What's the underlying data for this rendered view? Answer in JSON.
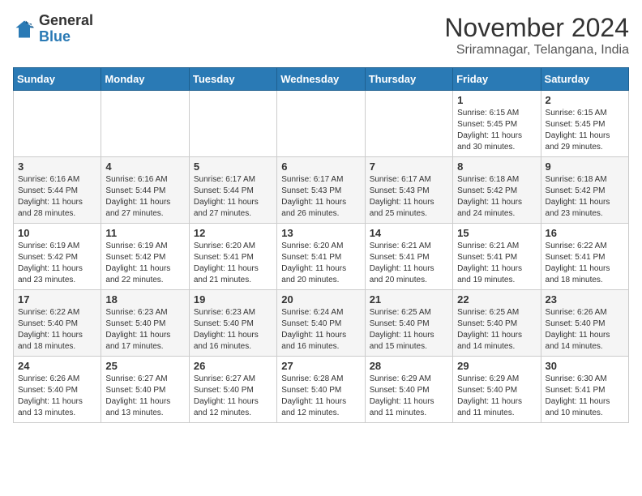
{
  "header": {
    "logo_general": "General",
    "logo_blue": "Blue",
    "title": "November 2024",
    "subtitle": "Sriramnagar, Telangana, India"
  },
  "weekdays": [
    "Sunday",
    "Monday",
    "Tuesday",
    "Wednesday",
    "Thursday",
    "Friday",
    "Saturday"
  ],
  "weeks": [
    [
      {
        "day": "",
        "info": ""
      },
      {
        "day": "",
        "info": ""
      },
      {
        "day": "",
        "info": ""
      },
      {
        "day": "",
        "info": ""
      },
      {
        "day": "",
        "info": ""
      },
      {
        "day": "1",
        "info": "Sunrise: 6:15 AM\nSunset: 5:45 PM\nDaylight: 11 hours and 30 minutes."
      },
      {
        "day": "2",
        "info": "Sunrise: 6:15 AM\nSunset: 5:45 PM\nDaylight: 11 hours and 29 minutes."
      }
    ],
    [
      {
        "day": "3",
        "info": "Sunrise: 6:16 AM\nSunset: 5:44 PM\nDaylight: 11 hours and 28 minutes."
      },
      {
        "day": "4",
        "info": "Sunrise: 6:16 AM\nSunset: 5:44 PM\nDaylight: 11 hours and 27 minutes."
      },
      {
        "day": "5",
        "info": "Sunrise: 6:17 AM\nSunset: 5:44 PM\nDaylight: 11 hours and 27 minutes."
      },
      {
        "day": "6",
        "info": "Sunrise: 6:17 AM\nSunset: 5:43 PM\nDaylight: 11 hours and 26 minutes."
      },
      {
        "day": "7",
        "info": "Sunrise: 6:17 AM\nSunset: 5:43 PM\nDaylight: 11 hours and 25 minutes."
      },
      {
        "day": "8",
        "info": "Sunrise: 6:18 AM\nSunset: 5:42 PM\nDaylight: 11 hours and 24 minutes."
      },
      {
        "day": "9",
        "info": "Sunrise: 6:18 AM\nSunset: 5:42 PM\nDaylight: 11 hours and 23 minutes."
      }
    ],
    [
      {
        "day": "10",
        "info": "Sunrise: 6:19 AM\nSunset: 5:42 PM\nDaylight: 11 hours and 23 minutes."
      },
      {
        "day": "11",
        "info": "Sunrise: 6:19 AM\nSunset: 5:42 PM\nDaylight: 11 hours and 22 minutes."
      },
      {
        "day": "12",
        "info": "Sunrise: 6:20 AM\nSunset: 5:41 PM\nDaylight: 11 hours and 21 minutes."
      },
      {
        "day": "13",
        "info": "Sunrise: 6:20 AM\nSunset: 5:41 PM\nDaylight: 11 hours and 20 minutes."
      },
      {
        "day": "14",
        "info": "Sunrise: 6:21 AM\nSunset: 5:41 PM\nDaylight: 11 hours and 20 minutes."
      },
      {
        "day": "15",
        "info": "Sunrise: 6:21 AM\nSunset: 5:41 PM\nDaylight: 11 hours and 19 minutes."
      },
      {
        "day": "16",
        "info": "Sunrise: 6:22 AM\nSunset: 5:41 PM\nDaylight: 11 hours and 18 minutes."
      }
    ],
    [
      {
        "day": "17",
        "info": "Sunrise: 6:22 AM\nSunset: 5:40 PM\nDaylight: 11 hours and 18 minutes."
      },
      {
        "day": "18",
        "info": "Sunrise: 6:23 AM\nSunset: 5:40 PM\nDaylight: 11 hours and 17 minutes."
      },
      {
        "day": "19",
        "info": "Sunrise: 6:23 AM\nSunset: 5:40 PM\nDaylight: 11 hours and 16 minutes."
      },
      {
        "day": "20",
        "info": "Sunrise: 6:24 AM\nSunset: 5:40 PM\nDaylight: 11 hours and 16 minutes."
      },
      {
        "day": "21",
        "info": "Sunrise: 6:25 AM\nSunset: 5:40 PM\nDaylight: 11 hours and 15 minutes."
      },
      {
        "day": "22",
        "info": "Sunrise: 6:25 AM\nSunset: 5:40 PM\nDaylight: 11 hours and 14 minutes."
      },
      {
        "day": "23",
        "info": "Sunrise: 6:26 AM\nSunset: 5:40 PM\nDaylight: 11 hours and 14 minutes."
      }
    ],
    [
      {
        "day": "24",
        "info": "Sunrise: 6:26 AM\nSunset: 5:40 PM\nDaylight: 11 hours and 13 minutes."
      },
      {
        "day": "25",
        "info": "Sunrise: 6:27 AM\nSunset: 5:40 PM\nDaylight: 11 hours and 13 minutes."
      },
      {
        "day": "26",
        "info": "Sunrise: 6:27 AM\nSunset: 5:40 PM\nDaylight: 11 hours and 12 minutes."
      },
      {
        "day": "27",
        "info": "Sunrise: 6:28 AM\nSunset: 5:40 PM\nDaylight: 11 hours and 12 minutes."
      },
      {
        "day": "28",
        "info": "Sunrise: 6:29 AM\nSunset: 5:40 PM\nDaylight: 11 hours and 11 minutes."
      },
      {
        "day": "29",
        "info": "Sunrise: 6:29 AM\nSunset: 5:40 PM\nDaylight: 11 hours and 11 minutes."
      },
      {
        "day": "30",
        "info": "Sunrise: 6:30 AM\nSunset: 5:41 PM\nDaylight: 11 hours and 10 minutes."
      }
    ]
  ]
}
